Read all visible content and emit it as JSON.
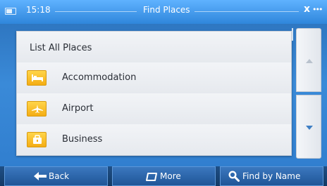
{
  "status": {
    "time": "15:18",
    "title": "Find Places",
    "signal_glyph": "x",
    "menu_glyph": "•••"
  },
  "list": {
    "items": [
      {
        "label": "List All Places"
      },
      {
        "label": "Accommodation",
        "icon": "bed-icon",
        "color": "#f4ad14"
      },
      {
        "label": "Airport",
        "icon": "airplane-icon",
        "color": "#f4ad14"
      },
      {
        "label": "Business",
        "icon": "briefcase-icon",
        "color": "#f4ad14"
      }
    ]
  },
  "bottom": {
    "back_label": "Back",
    "more_label": "More",
    "find_label": "Find by Name"
  },
  "colors": {
    "header_top": "#5fb2ff",
    "header_bottom": "#2f86db",
    "button_top": "#3b78bf",
    "button_bottom": "#1f5597",
    "icon_bg": "#f4ad14"
  }
}
